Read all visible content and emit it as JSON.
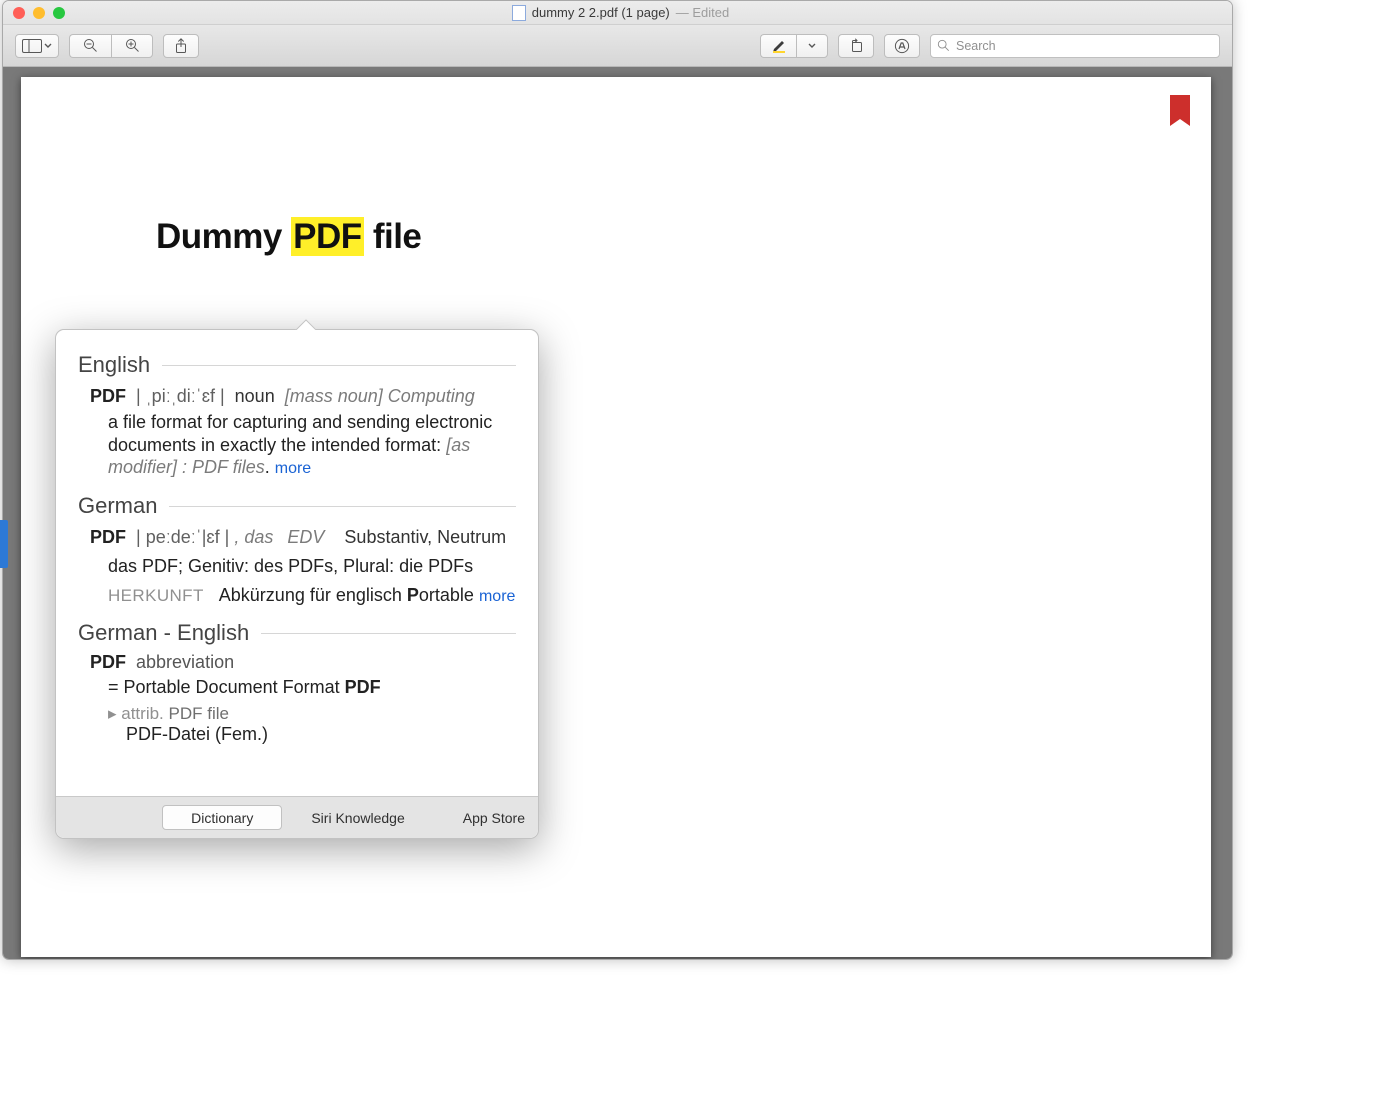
{
  "titlebar": {
    "filename": "dummy 2 2.pdf (1 page)",
    "status": "— Edited"
  },
  "toolbar": {
    "search_placeholder": "Search"
  },
  "document": {
    "title_prefix": "Dummy ",
    "title_highlight": "PDF",
    "title_suffix": " file"
  },
  "popover": {
    "english": {
      "lang": "English",
      "word": "PDF",
      "phonetic": "| ˌpiːˌdiːˈɛf |",
      "pos": "noun",
      "meta": "[mass noun] Computing",
      "definition": "a file format for capturing and sending electronic documents in exactly the intended format: ",
      "modifier": "[as modifier] : PDF files",
      "more": "more"
    },
    "german": {
      "lang": "German",
      "word": "PDF",
      "phonetic": "| peːdeːˈ|ɛf |",
      "meta1": ", das",
      "meta2": "EDV",
      "pos": "Substantiv, Neutrum",
      "forms": "das PDF; Genitiv: des PDFs, Plural: die PDFs",
      "origin_label": "HERKUNFT",
      "origin_text": "Abkürzung für englisch ",
      "origin_bold": "P",
      "origin_rest": "ortable",
      "more": "more"
    },
    "german_english": {
      "lang": "German - English",
      "word": "PDF",
      "abbr_label": "abbreviation",
      "equals_prefix": "= ",
      "equals_text": "Portable Document Format ",
      "equals_bold": "PDF",
      "attrib_marker": "▸ attrib. ",
      "attrib_text": "PDF file",
      "translation": "PDF-Datei (Fem.)"
    },
    "footer": {
      "dictionary": "Dictionary",
      "siri": "Siri Knowledge",
      "appstore": "App Store"
    }
  }
}
